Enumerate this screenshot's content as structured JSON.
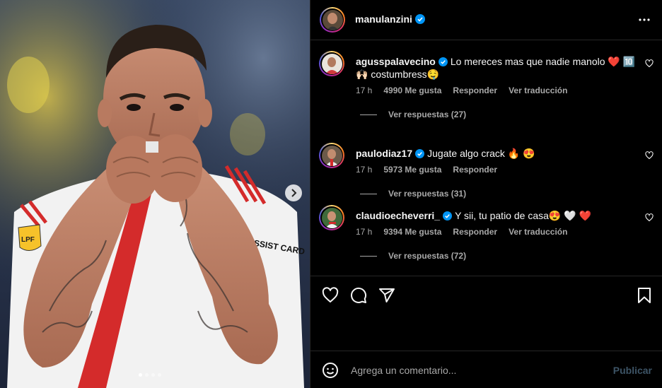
{
  "post": {
    "author": "manulanzini",
    "author_verified": true,
    "carousel": {
      "slides": 4,
      "active": 0
    },
    "photo_text": {
      "sponsor": "ASSIST CARD",
      "badge": "LPF"
    }
  },
  "comments": [
    {
      "username": "agusspalavecino",
      "verified": true,
      "text": "Lo mereces mas que nadie manolo ❤️ 🔟 🙌🏻 costumbress🤤",
      "time": "17 h",
      "likes": "4990 Me gusta",
      "reply_label": "Responder",
      "translate_label": "Ver traducción",
      "view_replies": "Ver respuestas (27)"
    },
    {
      "username": "paulodiaz17",
      "verified": true,
      "text": "Jugate algo crack 🔥 😍",
      "time": "17 h",
      "likes": "5973 Me gusta",
      "reply_label": "Responder",
      "view_replies": "Ver respuestas (31)"
    },
    {
      "username": "claudioecheverri_",
      "verified": true,
      "text": "Y sii, tu patio de casa😍 🤍 ❤️",
      "time": "17 h",
      "likes": "9394 Me gusta",
      "reply_label": "Responder",
      "translate_label": "Ver traducción",
      "view_replies": "Ver respuestas (72)"
    }
  ],
  "actions": {
    "icons": [
      "heart-icon",
      "comment-icon",
      "share-icon",
      "bookmark-icon"
    ]
  },
  "composer": {
    "placeholder": "Agrega un comentario...",
    "publish_label": "Publicar"
  },
  "colors": {
    "background": "#000000",
    "verified_blue": "#0095f6",
    "secondary_text": "#a8a8a8",
    "publish_disabled": "#3d5466",
    "jersey_red": "#d42b2b"
  }
}
